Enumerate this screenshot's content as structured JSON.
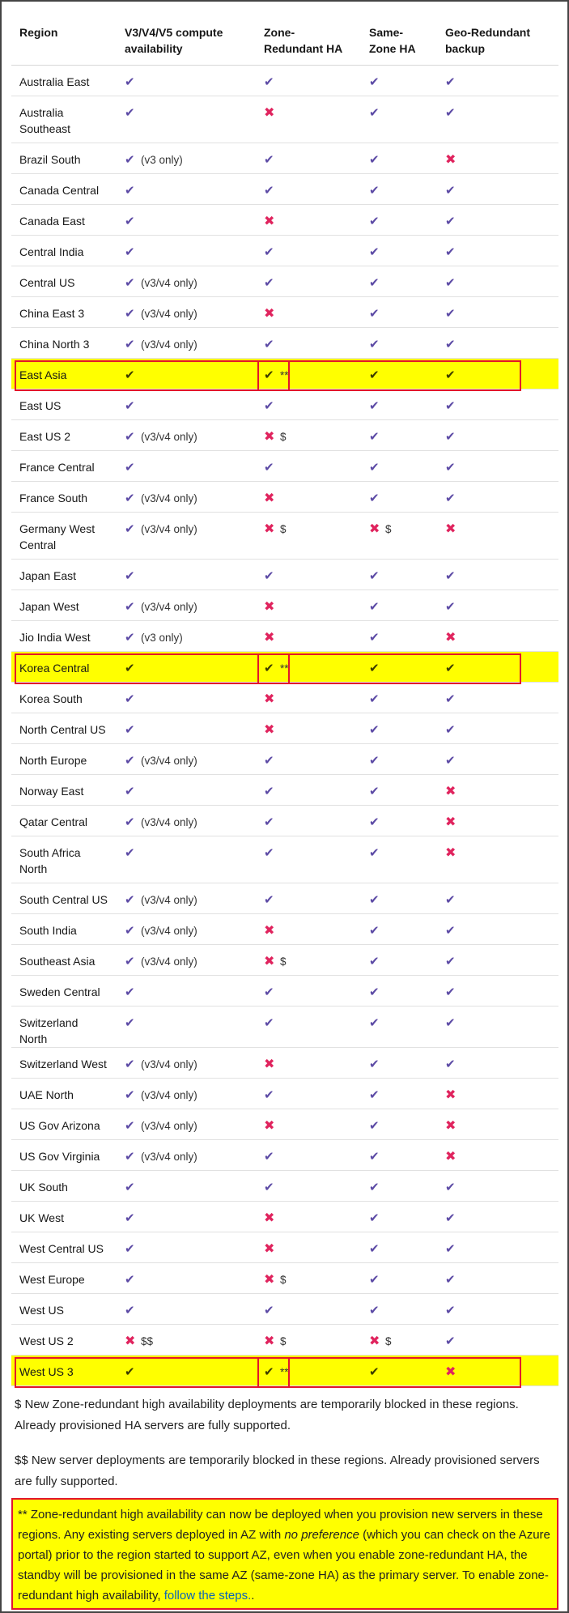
{
  "table": {
    "headers": [
      "Region",
      "V3/V4/V5 compute availability",
      "Zone-Redundant HA",
      "Same-Zone HA",
      "Geo-Redundant backup"
    ],
    "rows": [
      {
        "region": "Australia East",
        "compute": "check",
        "compute_note": "",
        "zr": "check",
        "zr_note": "",
        "sz": "check",
        "sz_note": "",
        "geo": "check",
        "lines": 1
      },
      {
        "region": "Australia Southeast",
        "compute": "check",
        "compute_note": "",
        "zr": "cross",
        "zr_note": "",
        "sz": "check",
        "sz_note": "",
        "geo": "check",
        "lines": 2
      },
      {
        "region": "Brazil South",
        "compute": "check",
        "compute_note": "(v3 only)",
        "zr": "check",
        "zr_note": "",
        "sz": "check",
        "sz_note": "",
        "geo": "cross",
        "lines": 1
      },
      {
        "region": "Canada Central",
        "compute": "check",
        "compute_note": "",
        "zr": "check",
        "zr_note": "",
        "sz": "check",
        "sz_note": "",
        "geo": "check",
        "lines": 1
      },
      {
        "region": "Canada East",
        "compute": "check",
        "compute_note": "",
        "zr": "cross",
        "zr_note": "",
        "sz": "check",
        "sz_note": "",
        "geo": "check",
        "lines": 1
      },
      {
        "region": "Central India",
        "compute": "check",
        "compute_note": "",
        "zr": "check",
        "zr_note": "",
        "sz": "check",
        "sz_note": "",
        "geo": "check",
        "lines": 1
      },
      {
        "region": "Central US",
        "compute": "check",
        "compute_note": "(v3/v4 only)",
        "zr": "check",
        "zr_note": "",
        "sz": "check",
        "sz_note": "",
        "geo": "check",
        "lines": 1
      },
      {
        "region": "China East 3",
        "compute": "check",
        "compute_note": "(v3/v4 only)",
        "zr": "cross",
        "zr_note": "",
        "sz": "check",
        "sz_note": "",
        "geo": "check",
        "lines": 1
      },
      {
        "region": "China North 3",
        "compute": "check",
        "compute_note": "(v3/v4 only)",
        "zr": "check",
        "zr_note": "",
        "sz": "check",
        "sz_note": "",
        "geo": "check",
        "lines": 1
      },
      {
        "region": "East Asia",
        "compute": "check",
        "compute_note": "",
        "zr": "check",
        "zr_note": "**",
        "sz": "check",
        "sz_note": "",
        "geo": "check",
        "lines": 1,
        "highlight": true
      },
      {
        "region": "East US",
        "compute": "check",
        "compute_note": "",
        "zr": "check",
        "zr_note": "",
        "sz": "check",
        "sz_note": "",
        "geo": "check",
        "lines": 1
      },
      {
        "region": "East US 2",
        "compute": "check",
        "compute_note": "(v3/v4 only)",
        "zr": "cross",
        "zr_note": "$",
        "sz": "check",
        "sz_note": "",
        "geo": "check",
        "lines": 1
      },
      {
        "region": "France Central",
        "compute": "check",
        "compute_note": "",
        "zr": "check",
        "zr_note": "",
        "sz": "check",
        "sz_note": "",
        "geo": "check",
        "lines": 1
      },
      {
        "region": "France South",
        "compute": "check",
        "compute_note": "(v3/v4 only)",
        "zr": "cross",
        "zr_note": "",
        "sz": "check",
        "sz_note": "",
        "geo": "check",
        "lines": 1
      },
      {
        "region": "Germany West Central",
        "compute": "check",
        "compute_note": "(v3/v4 only)",
        "zr": "cross",
        "zr_note": "$",
        "sz": "cross",
        "sz_note": "$",
        "geo": "cross",
        "lines": 2
      },
      {
        "region": "Japan East",
        "compute": "check",
        "compute_note": "",
        "zr": "check",
        "zr_note": "",
        "sz": "check",
        "sz_note": "",
        "geo": "check",
        "lines": 1
      },
      {
        "region": "Japan West",
        "compute": "check",
        "compute_note": "(v3/v4 only)",
        "zr": "cross",
        "zr_note": "",
        "sz": "check",
        "sz_note": "",
        "geo": "check",
        "lines": 1
      },
      {
        "region": "Jio India West",
        "compute": "check",
        "compute_note": "(v3 only)",
        "zr": "cross",
        "zr_note": "",
        "sz": "check",
        "sz_note": "",
        "geo": "cross",
        "lines": 1
      },
      {
        "region": "Korea Central",
        "compute": "check",
        "compute_note": "",
        "zr": "check",
        "zr_note": "**",
        "sz": "check",
        "sz_note": "",
        "geo": "check",
        "lines": 1,
        "highlight": true
      },
      {
        "region": "Korea South",
        "compute": "check",
        "compute_note": "",
        "zr": "cross",
        "zr_note": "",
        "sz": "check",
        "sz_note": "",
        "geo": "check",
        "lines": 1
      },
      {
        "region": "North Central US",
        "compute": "check",
        "compute_note": "",
        "zr": "cross",
        "zr_note": "",
        "sz": "check",
        "sz_note": "",
        "geo": "check",
        "lines": 1
      },
      {
        "region": "North Europe",
        "compute": "check",
        "compute_note": "(v3/v4 only)",
        "zr": "check",
        "zr_note": "",
        "sz": "check",
        "sz_note": "",
        "geo": "check",
        "lines": 1
      },
      {
        "region": "Norway East",
        "compute": "check",
        "compute_note": "",
        "zr": "check",
        "zr_note": "",
        "sz": "check",
        "sz_note": "",
        "geo": "cross",
        "lines": 1
      },
      {
        "region": "Qatar Central",
        "compute": "check",
        "compute_note": "(v3/v4 only)",
        "zr": "check",
        "zr_note": "",
        "sz": "check",
        "sz_note": "",
        "geo": "cross",
        "lines": 1
      },
      {
        "region": "South Africa North",
        "compute": "check",
        "compute_note": "",
        "zr": "check",
        "zr_note": "",
        "sz": "check",
        "sz_note": "",
        "geo": "cross",
        "lines": 2
      },
      {
        "region": "South Central US",
        "compute": "check",
        "compute_note": "(v3/v4 only)",
        "zr": "check",
        "zr_note": "",
        "sz": "check",
        "sz_note": "",
        "geo": "check",
        "lines": 1
      },
      {
        "region": "South India",
        "compute": "check",
        "compute_note": "(v3/v4 only)",
        "zr": "cross",
        "zr_note": "",
        "sz": "check",
        "sz_note": "",
        "geo": "check",
        "lines": 1
      },
      {
        "region": "Southeast Asia",
        "compute": "check",
        "compute_note": "(v3/v4 only)",
        "zr": "cross",
        "zr_note": "$",
        "sz": "check",
        "sz_note": "",
        "geo": "check",
        "lines": 1
      },
      {
        "region": "Sweden Central",
        "compute": "check",
        "compute_note": "",
        "zr": "check",
        "zr_note": "",
        "sz": "check",
        "sz_note": "",
        "geo": "check",
        "lines": 1
      },
      {
        "region": "Switzerland North",
        "compute": "check",
        "compute_note": "",
        "zr": "check",
        "zr_note": "",
        "sz": "check",
        "sz_note": "",
        "geo": "check",
        "lines": 1
      },
      {
        "region": "Switzerland West",
        "compute": "check",
        "compute_note": "(v3/v4 only)",
        "zr": "cross",
        "zr_note": "",
        "sz": "check",
        "sz_note": "",
        "geo": "check",
        "lines": 1
      },
      {
        "region": "UAE North",
        "compute": "check",
        "compute_note": "(v3/v4 only)",
        "zr": "check",
        "zr_note": "",
        "sz": "check",
        "sz_note": "",
        "geo": "cross",
        "lines": 1
      },
      {
        "region": "US Gov Arizona",
        "compute": "check",
        "compute_note": "(v3/v4 only)",
        "zr": "cross",
        "zr_note": "",
        "sz": "check",
        "sz_note": "",
        "geo": "cross",
        "lines": 1
      },
      {
        "region": "US Gov Virginia",
        "compute": "check",
        "compute_note": "(v3/v4 only)",
        "zr": "check",
        "zr_note": "",
        "sz": "check",
        "sz_note": "",
        "geo": "cross",
        "lines": 1
      },
      {
        "region": "UK South",
        "compute": "check",
        "compute_note": "",
        "zr": "check",
        "zr_note": "",
        "sz": "check",
        "sz_note": "",
        "geo": "check",
        "lines": 1
      },
      {
        "region": "UK West",
        "compute": "check",
        "compute_note": "",
        "zr": "cross",
        "zr_note": "",
        "sz": "check",
        "sz_note": "",
        "geo": "check",
        "lines": 1
      },
      {
        "region": "West Central US",
        "compute": "check",
        "compute_note": "",
        "zr": "cross",
        "zr_note": "",
        "sz": "check",
        "sz_note": "",
        "geo": "check",
        "lines": 1
      },
      {
        "region": "West Europe",
        "compute": "check",
        "compute_note": "",
        "zr": "cross",
        "zr_note": "$",
        "sz": "check",
        "sz_note": "",
        "geo": "check",
        "lines": 1
      },
      {
        "region": "West US",
        "compute": "check",
        "compute_note": "",
        "zr": "check",
        "zr_note": "",
        "sz": "check",
        "sz_note": "",
        "geo": "check",
        "lines": 1
      },
      {
        "region": "West US 2",
        "compute": "cross",
        "compute_note": "$$",
        "zr": "cross",
        "zr_note": "$",
        "sz": "cross",
        "sz_note": "$",
        "geo": "check",
        "lines": 1
      },
      {
        "region": "West US 3",
        "compute": "check",
        "compute_note": "",
        "zr": "check",
        "zr_note": "**",
        "sz": "check",
        "sz_note": "",
        "geo": "cross",
        "lines": 1,
        "highlight": true
      }
    ]
  },
  "icons": {
    "check": "check-icon",
    "cross": "cross-icon"
  },
  "colors": {
    "check": "#5c4aa5",
    "cross": "#e0245e",
    "highlight": "#ffff00",
    "highlight_border": "#e3152b",
    "link": "#0b64b8"
  },
  "footnotes": {
    "dollar": "$ New Zone-redundant high availability deployments are temporarily blocked in these regions. Already provisioned HA servers are fully supported.",
    "double_dollar": "$$ New server deployments are temporarily blocked in these regions. Already provisioned servers are fully supported.",
    "star_part1": "** Zone-redundant high availability can now be deployed when you provision new servers in these regions. Any existing servers deployed in AZ with ",
    "star_em": "no preference",
    "star_part2": " (which you can check on the Azure portal) prior to the region started to support AZ, even when you enable zone-redundant HA, the standby will be provisioned in the same AZ (same-zone HA) as the primary server. To enable zone-redundant high availability, ",
    "star_link": "follow the steps.",
    "star_end": "."
  }
}
